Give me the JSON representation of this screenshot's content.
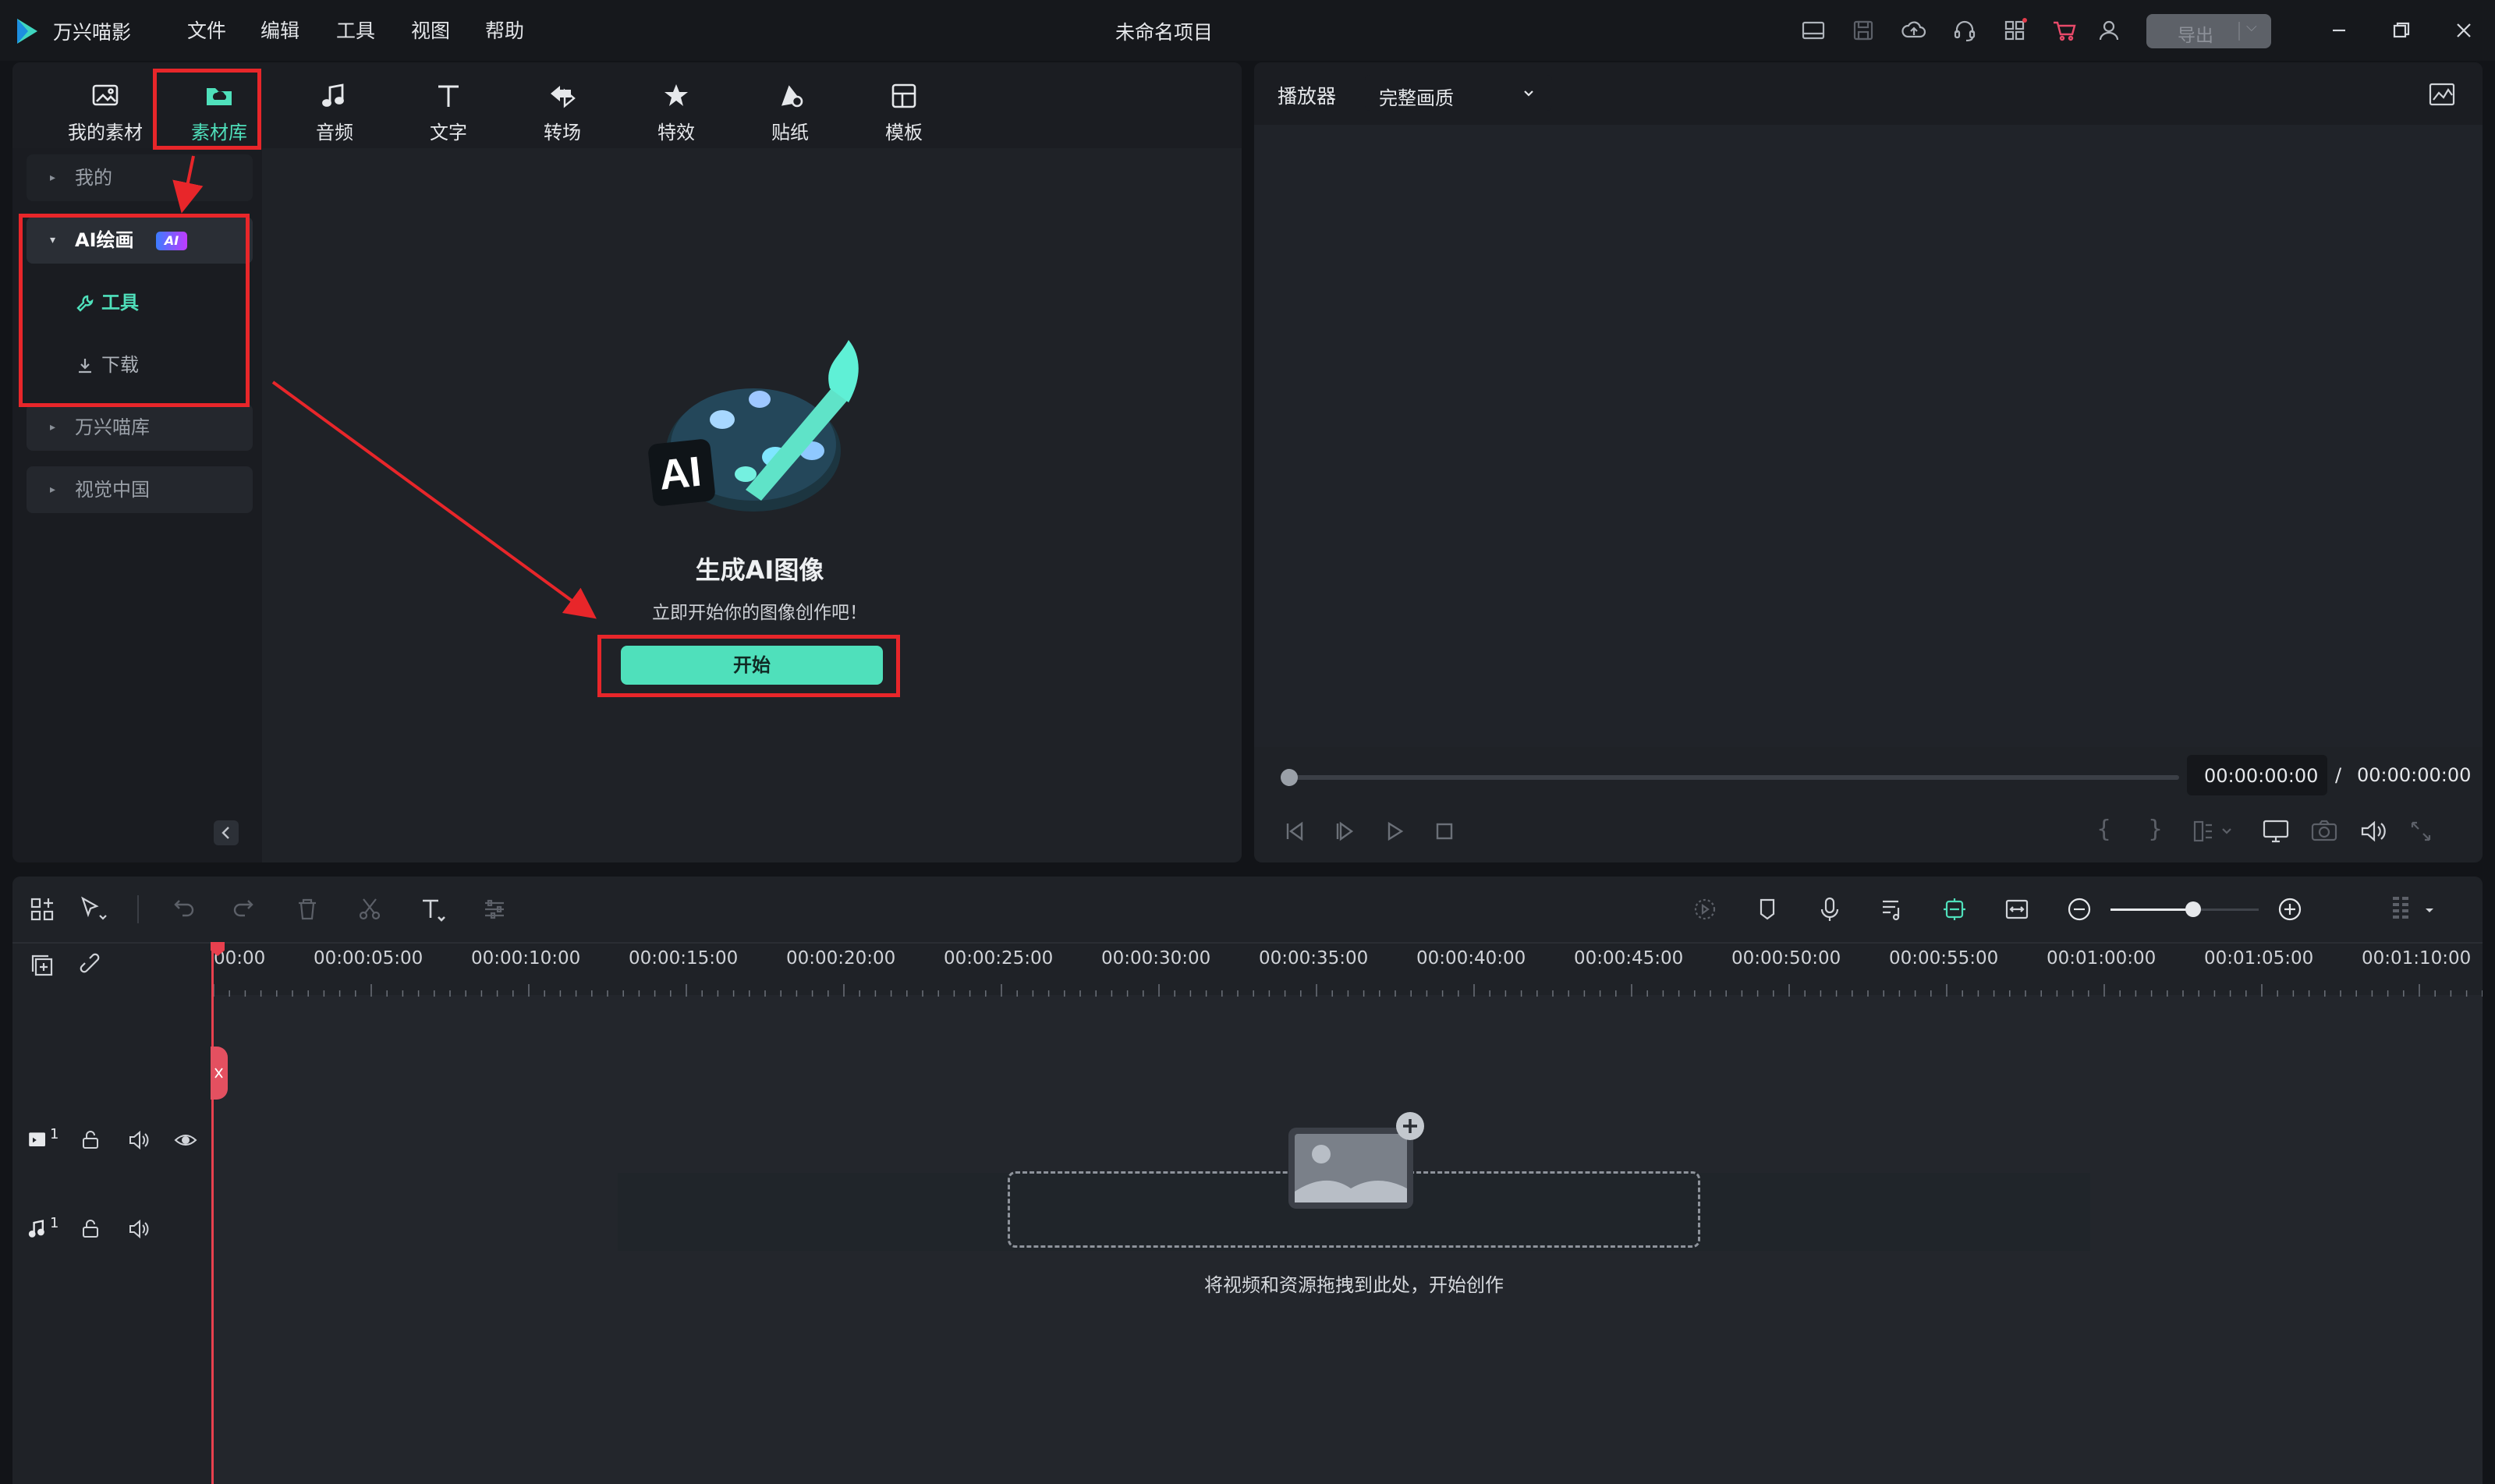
{
  "app": {
    "name": "万兴喵影",
    "project_title": "未命名项目"
  },
  "menu": [
    "文件",
    "编辑",
    "工具",
    "视图",
    "帮助"
  ],
  "titlebar": {
    "export_label": "导出"
  },
  "toolbar_tabs": [
    {
      "label": "我的素材",
      "icon": "my-media-icon"
    },
    {
      "label": "素材库",
      "icon": "library-folder-icon",
      "active": true
    },
    {
      "label": "音频",
      "icon": "music-note-icon"
    },
    {
      "label": "文字",
      "icon": "text-icon"
    },
    {
      "label": "转场",
      "icon": "transition-icon"
    },
    {
      "label": "特效",
      "icon": "effects-icon"
    },
    {
      "label": "贴纸",
      "icon": "sticker-icon"
    },
    {
      "label": "模板",
      "icon": "template-icon"
    }
  ],
  "sidebar": {
    "mine": "我的",
    "ai_drawing": "AI绘画",
    "ai_badge": "AI",
    "tools": "工具",
    "download": "下载",
    "wondershare_library": "万兴喵库",
    "visual_china": "视觉中国"
  },
  "content": {
    "title": "生成AI图像",
    "subtitle": "立即开始你的图像创作吧！",
    "start_button": "开始",
    "illustration_text": "AI"
  },
  "player": {
    "label": "播放器",
    "quality": "完整画质",
    "current_time": "00:00:00:00",
    "separator": "/",
    "total_time": "00:00:00:00"
  },
  "timeline": {
    "ruler": [
      "00:00",
      "00:00:05:00",
      "00:00:10:00",
      "00:00:15:00",
      "00:00:20:00",
      "00:00:25:00",
      "00:00:30:00",
      "00:00:35:00",
      "00:00:40:00",
      "00:00:45:00",
      "00:00:50:00",
      "00:00:55:00",
      "00:01:00:00",
      "00:01:05:00",
      "00:01:10:00"
    ],
    "video_track_number": "1",
    "audio_track_number": "1",
    "drop_hint": "将视频和资源拖拽到此处，开始创作",
    "zoom_level": 0.56
  },
  "colors": {
    "accent": "#4fe0bb",
    "annotation": "#e8262a",
    "bg_panel": "#1f2227",
    "bg_dark": "#16181c"
  }
}
